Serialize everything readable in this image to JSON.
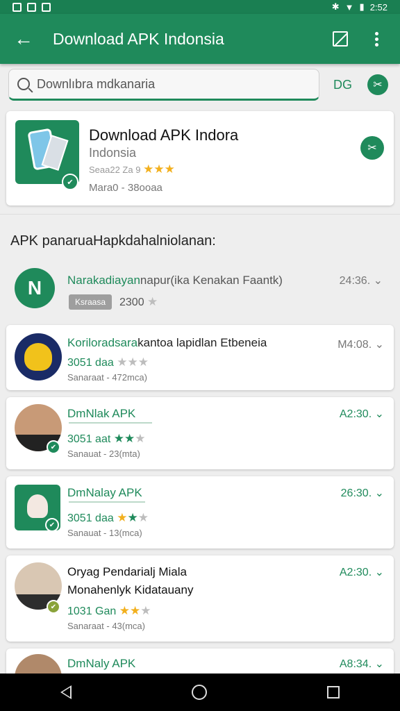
{
  "status": {
    "time": "2:52"
  },
  "appbar": {
    "title": "Download APK Indonsia",
    "back_icon": "arrow-left-icon",
    "edit_icon": "edit-box-icon",
    "menu_icon": "more-vert-icon"
  },
  "search": {
    "value": "Downlıbra mdkanaria",
    "side_label": "DG"
  },
  "featured": {
    "title": "Download APK Indora",
    "subtitle": "Indonsia",
    "rating_text": "Seaa22 Za 9",
    "size_text": "Mara0 - 38ooaa"
  },
  "section_title": "APK panaruaHapkdahalniolanan:",
  "list": [
    {
      "name_green": "Narakadiayan",
      "name_rest": "napur(ika Kenakan Faantk)",
      "pill": "Ksraasa",
      "count": "2300",
      "time": "24:36."
    },
    {
      "name_green": "Koriloradsara",
      "name_rest": "kantoa lapidlan Etbeneia",
      "rating_text": "3051 daa",
      "meta": "Sanaraat - 472mca)",
      "time": "M4:08."
    },
    {
      "name_green": "DmNlak APK",
      "rating_text": "3051 aat",
      "meta": "Sanauat - 23(mta)",
      "time": "A2:30."
    },
    {
      "name_green": "DmNalay APK",
      "rating_text": "3051 daa",
      "meta": "Sanauat - 13(mca)",
      "time": "26:30."
    },
    {
      "name_line1": "Oryag Pendarialj Miala",
      "name_line2": "Monahenlyk Kidatauany",
      "rating_text": "1031 Gan",
      "meta": "Sanaraat - 43(mca)",
      "time": "A2:30."
    },
    {
      "name_green": "DmNaly APK",
      "time": "A8:34."
    }
  ],
  "colors": {
    "primary": "#1f8a5b",
    "star_gold": "#f2b01e"
  }
}
